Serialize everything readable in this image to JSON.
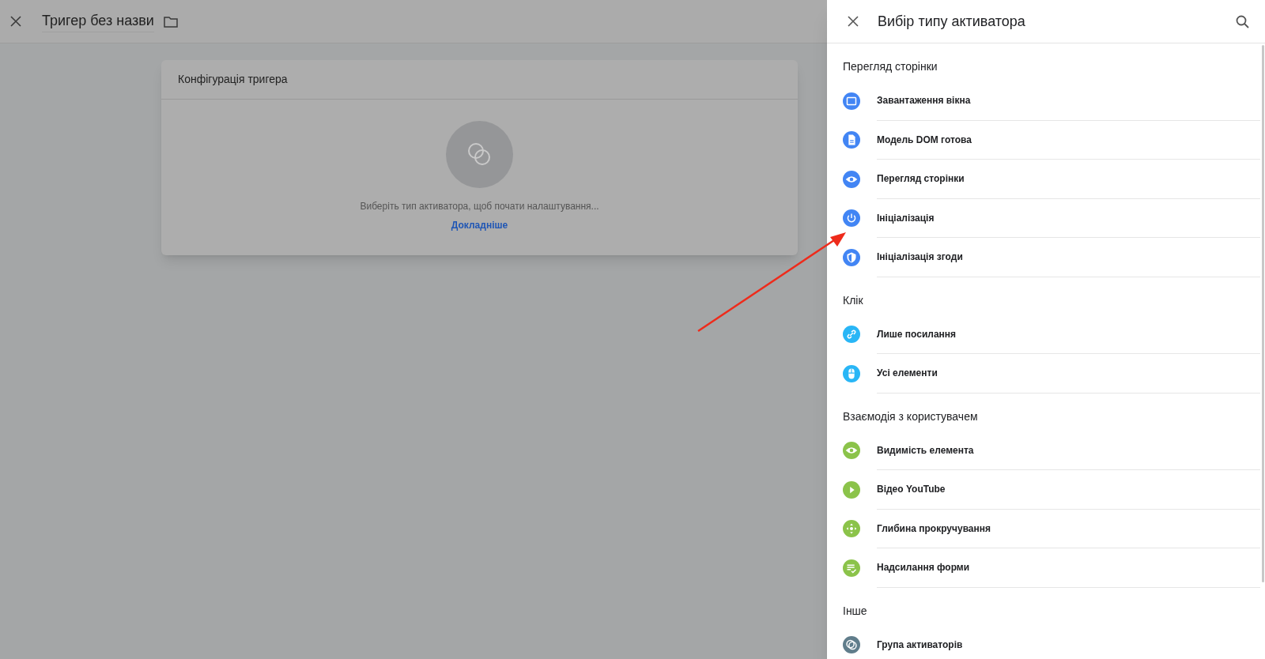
{
  "editor": {
    "title": "Тригер без назви",
    "card": {
      "title": "Конфігурація тригера",
      "message": "Виберіть тип активатора, щоб почати налаштування...",
      "link": "Докладніше"
    }
  },
  "panel": {
    "title": "Вибір типу активатора",
    "sections": [
      {
        "title": "Перегляд сторінки",
        "items": [
          {
            "label": "Завантаження вікна",
            "kind": "window",
            "color": "#4285f4"
          },
          {
            "label": "Модель DOM готова",
            "kind": "document",
            "color": "#4285f4"
          },
          {
            "label": "Перегляд сторінки",
            "kind": "eye",
            "color": "#4285f4"
          },
          {
            "label": "Ініціалізація",
            "kind": "power",
            "color": "#4285f4"
          },
          {
            "label": "Ініціалізація згоди",
            "kind": "shield",
            "color": "#4285f4"
          }
        ]
      },
      {
        "title": "Клік",
        "items": [
          {
            "label": "Лише посилання",
            "kind": "link",
            "color": "#29b6f6"
          },
          {
            "label": "Усі елементи",
            "kind": "mouse",
            "color": "#29b6f6"
          }
        ]
      },
      {
        "title": "Взаємодія з користувачем",
        "items": [
          {
            "label": "Видимість елемента",
            "kind": "eye",
            "color": "#8bc34a"
          },
          {
            "label": "Відео YouTube",
            "kind": "play",
            "color": "#8bc34a"
          },
          {
            "label": "Глибина прокручування",
            "kind": "move",
            "color": "#8bc34a"
          },
          {
            "label": "Надсилання форми",
            "kind": "form",
            "color": "#8bc34a"
          }
        ]
      },
      {
        "title": "Інше",
        "items": [
          {
            "label": "Група активаторів",
            "kind": "group",
            "color": "#607d8b"
          }
        ]
      }
    ]
  }
}
